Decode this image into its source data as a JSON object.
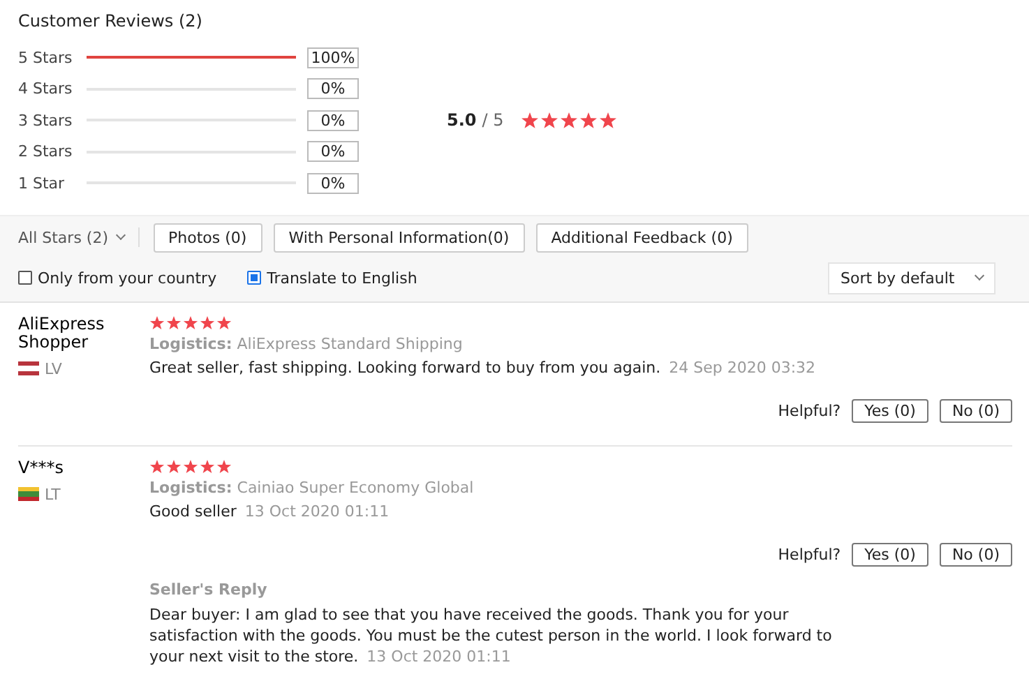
{
  "title": "Customer Reviews (2)",
  "distribution": [
    {
      "label": "5 Stars",
      "level": 1,
      "percent": "100%"
    },
    {
      "label": "4 Stars",
      "level": 0,
      "percent": "0%"
    },
    {
      "label": "3 Stars",
      "level": 0,
      "percent": "0%"
    },
    {
      "label": "2 Stars",
      "level": 0,
      "percent": "0%"
    },
    {
      "label": "1 Star",
      "level": 0,
      "percent": "0%"
    }
  ],
  "rating": {
    "score": "5.0",
    "out_of": "/ 5",
    "stars": 5
  },
  "filters": {
    "dropdown": "All Stars (2)",
    "buttons": [
      "Photos (0)",
      "With Personal Information(0)",
      "Additional Feedback (0)"
    ],
    "checkboxes": [
      {
        "label": "Only from your country",
        "checked": false
      },
      {
        "label": "Translate to English",
        "checked": true
      }
    ],
    "sort": "Sort by default"
  },
  "reviews": [
    {
      "name": "AliExpress Shopper",
      "country": "LV",
      "flag": {
        "kind": "latvia"
      },
      "stars": 5,
      "logistics_label": "Logistics:",
      "logistics": "AliExpress Standard Shipping",
      "text": "Great seller, fast shipping. Looking forward to buy from you again.",
      "date": "24 Sep 2020 03:32",
      "helpful": "Helpful?",
      "yes": "Yes (0)",
      "no": "No (0)"
    },
    {
      "name": "V***s",
      "country": "LT",
      "flag": {
        "kind": "lithuania"
      },
      "stars": 5,
      "logistics_label": "Logistics:",
      "logistics": "Cainiao Super Economy Global",
      "text": "Good seller",
      "date": "13 Oct 2020 01:11",
      "helpful": "Helpful?",
      "yes": "Yes (0)",
      "no": "No (0)",
      "reply": {
        "title": "Seller's Reply",
        "text": "Dear buyer: I am glad to see that you have received the goods. Thank you for your satisfaction with the goods. You must be the cutest person in the world. I look forward to your next visit to the store.",
        "date": "13 Oct 2020 01:11"
      }
    }
  ]
}
